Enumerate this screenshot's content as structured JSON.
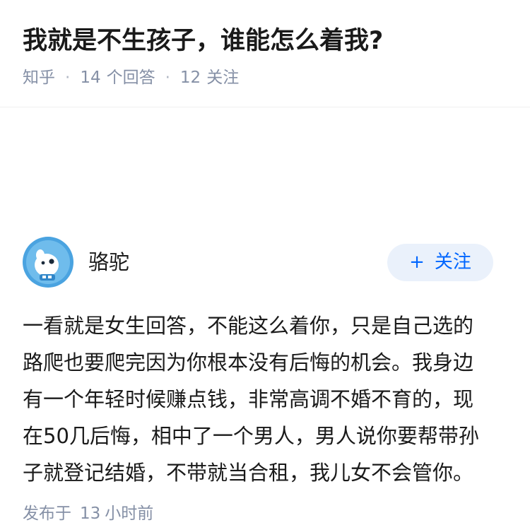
{
  "question": {
    "title": "我就是不生孩子，谁能怎么着我?",
    "source": "知乎",
    "answer_count": "14",
    "answer_label": "个回答",
    "follower_count": "12",
    "follower_label": "关注"
  },
  "answer": {
    "author_name": "骆驼",
    "follow_button": {
      "icon": "+",
      "label": "关注"
    },
    "body_lines": [
      "一看就是女生回答，不能这么着你，只是自己选的",
      "路爬也要爬完因为你根本没有后悔的机会。我身边",
      "有一个年轻时候赚点钱，非常高调不婚不育的，现",
      "在50几后悔，相中了一个男人，男人说你要帮带孙",
      "子就登记结婚，不带就当合租，我儿女不会管你。"
    ],
    "published": {
      "prefix": "发布于",
      "value": "13",
      "unit": "小时前"
    }
  },
  "colors": {
    "accent": "#0066ff",
    "follow_bg": "#eaf1fb",
    "meta": "#8590a6",
    "avatar_blue": "#4aa3e0"
  }
}
